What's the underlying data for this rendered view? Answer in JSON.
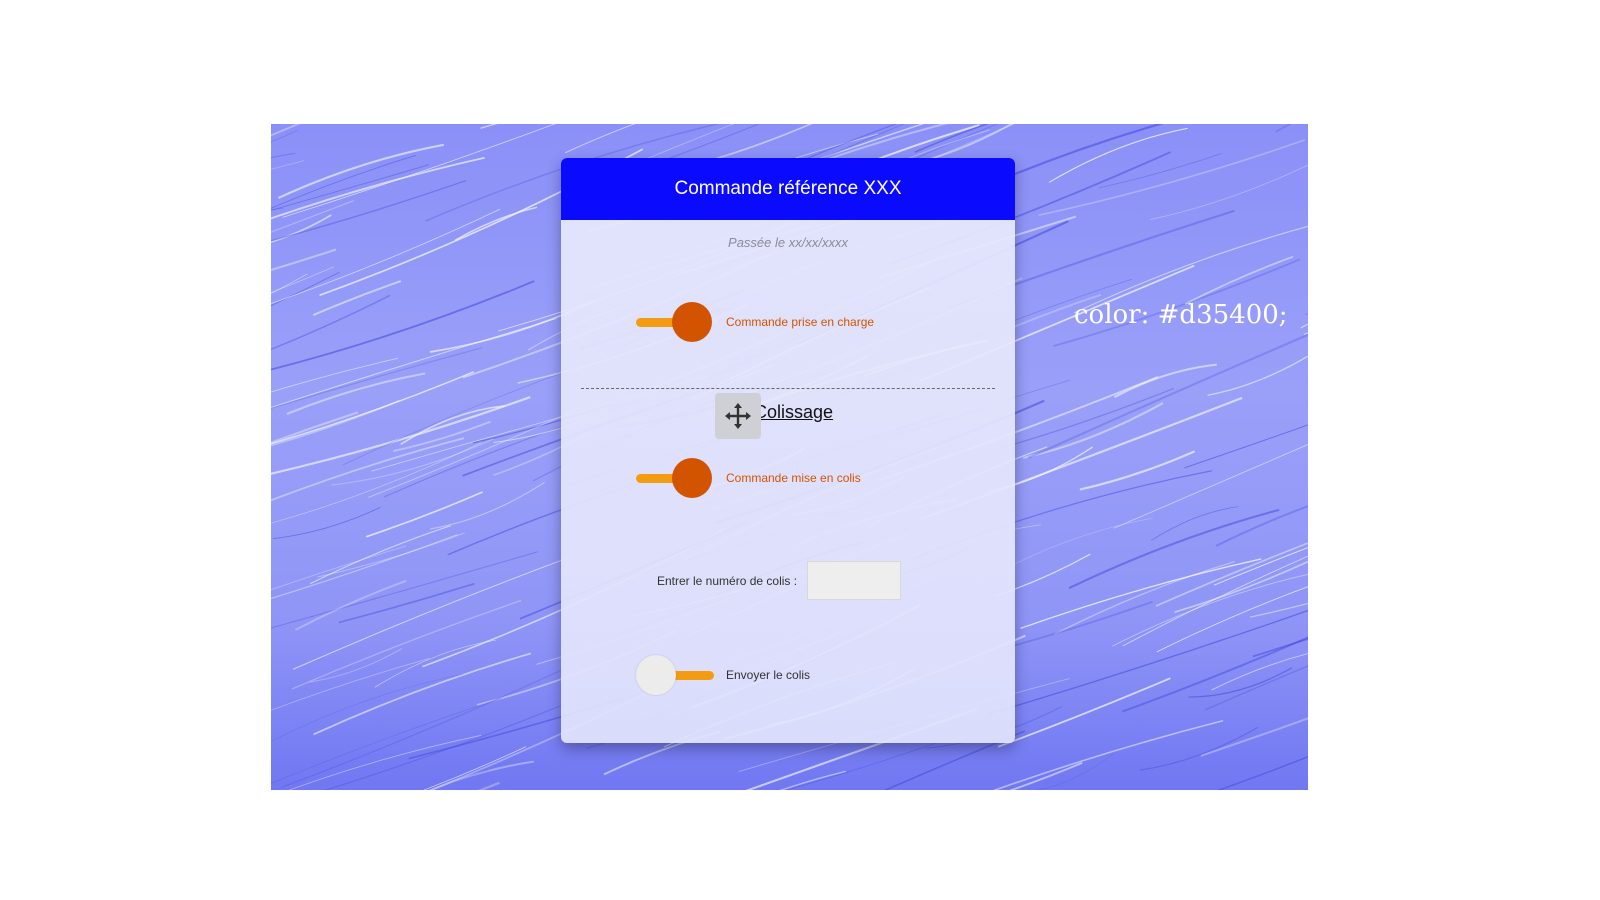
{
  "background": {
    "note": "color: #d35400;"
  },
  "order": {
    "title": "Commande référence XXX",
    "date_line": "Passée le xx/xx/xxxx"
  },
  "steps": {
    "taken": {
      "label": "Commande prise en charge",
      "checked": true
    },
    "packing_section": "Colissage",
    "packed": {
      "label": "Commande mise en colis",
      "checked": true
    },
    "parcel_field": {
      "label": "Entrer le numéro de colis :",
      "value": "",
      "placeholder": ""
    },
    "send": {
      "label": "Envoyer le colis",
      "checked": false
    }
  },
  "colors": {
    "header": "#0a0aff",
    "accent": "#d35400",
    "track": "#f39c12"
  },
  "icons": {
    "move_handle": "move-arrows-icon"
  }
}
